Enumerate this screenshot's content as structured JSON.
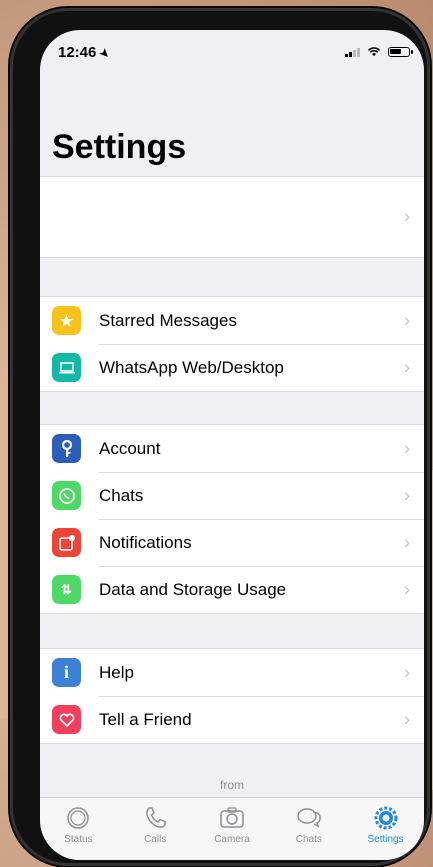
{
  "status_bar": {
    "time": "12:46"
  },
  "page_title": "Settings",
  "groups": [
    [
      {
        "icon": "star-icon",
        "label": "Starred Messages",
        "color": "#f7c21a"
      },
      {
        "icon": "laptop-icon",
        "label": "WhatsApp Web/Desktop",
        "color": "#13b8a6"
      }
    ],
    [
      {
        "icon": "key-icon",
        "label": "Account",
        "color": "#2c5db9"
      },
      {
        "icon": "whatsapp-icon",
        "label": "Chats",
        "color": "#4cd964"
      },
      {
        "icon": "notification-icon",
        "label": "Notifications",
        "color": "#f04438"
      },
      {
        "icon": "data-arrows-icon",
        "label": "Data and Storage Usage",
        "color": "#4cd964"
      }
    ],
    [
      {
        "icon": "info-icon",
        "label": "Help",
        "color": "#3b82d6"
      },
      {
        "icon": "heart-icon",
        "label": "Tell a Friend",
        "color": "#f33f5c"
      }
    ]
  ],
  "footer_text": "from",
  "tabs": [
    {
      "label": "Status",
      "icon": "status-icon"
    },
    {
      "label": "Calls",
      "icon": "phone-icon"
    },
    {
      "label": "Camera",
      "icon": "camera-icon"
    },
    {
      "label": "Chats",
      "icon": "chat-bubbles-icon"
    },
    {
      "label": "Settings",
      "icon": "gear-icon",
      "active": true
    }
  ],
  "colors": {
    "active_tab": "#1e88e5",
    "background": "#efeff4"
  }
}
